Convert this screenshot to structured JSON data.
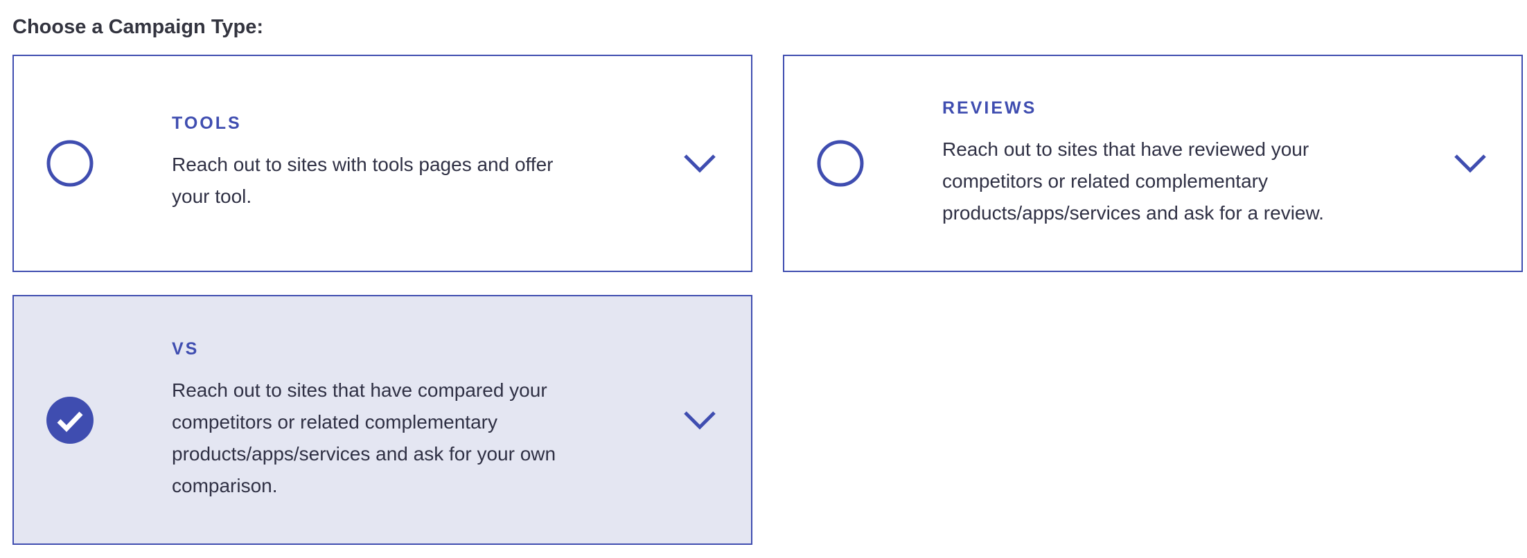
{
  "heading": "Choose a Campaign Type:",
  "colors": {
    "accent": "#3f4db0",
    "selected_background": "#e4e6f2",
    "text": "#2f3044"
  },
  "campaign_types": [
    {
      "title": "TOOLS",
      "description": "Reach out to sites with tools pages and offer your tool.",
      "selected": false,
      "expand_icon": "chevron-down-icon"
    },
    {
      "title": "REVIEWS",
      "description": "Reach out to sites that have reviewed your competitors or related complementary products/apps/services and ask for a review.",
      "selected": false,
      "expand_icon": "chevron-down-icon"
    },
    {
      "title": "VS",
      "description": "Reach out to sites that have compared your competitors or related complementary products/apps/services and ask for your own comparison.",
      "selected": true,
      "expand_icon": "chevron-down-icon"
    }
  ]
}
